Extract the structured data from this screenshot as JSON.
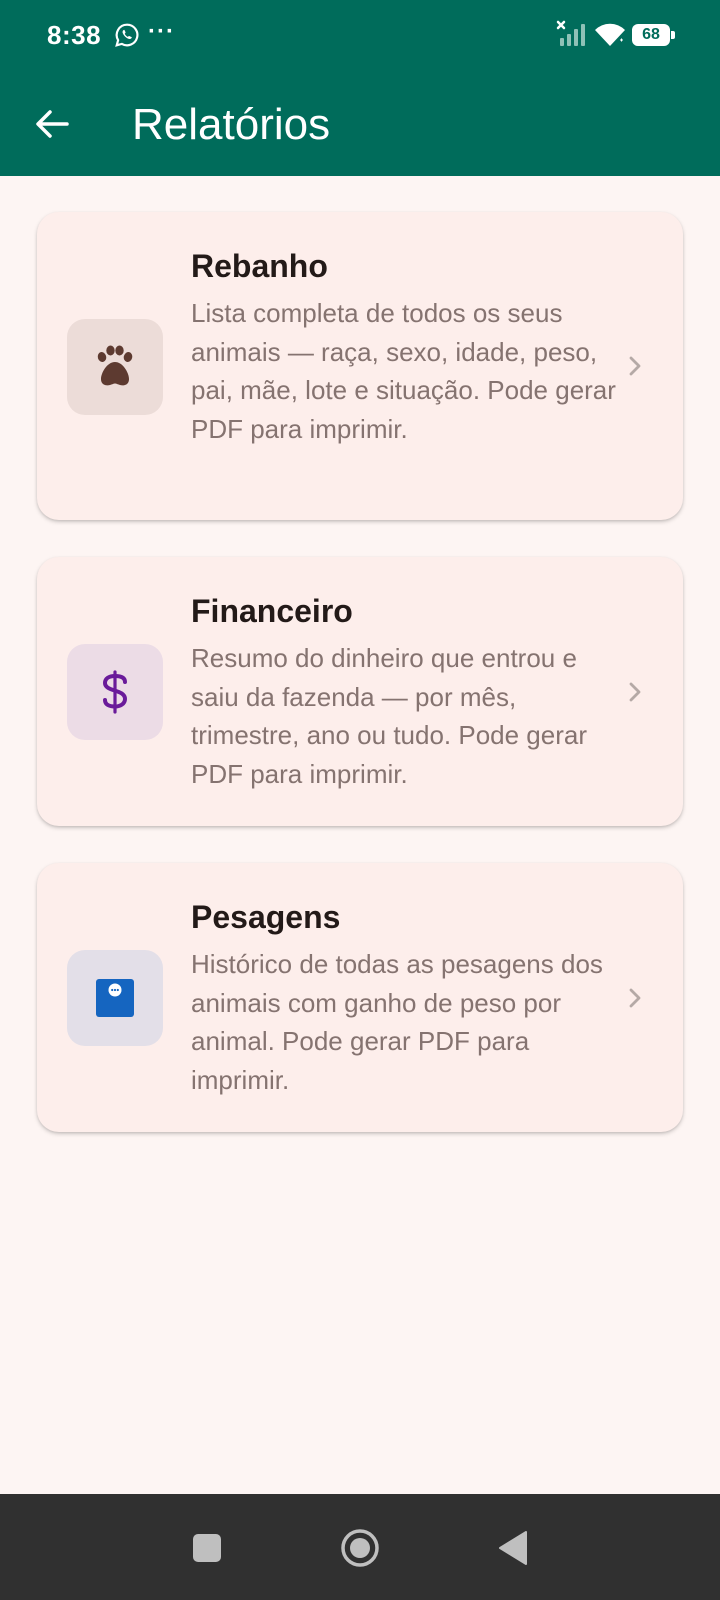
{
  "status_bar": {
    "time": "8:38",
    "more": "···",
    "battery": "68"
  },
  "app_bar": {
    "title": "Relatórios",
    "back_icon": "arrow-left-icon"
  },
  "reports": [
    {
      "title": "Rebanho",
      "description": "Lista completa de todos os seus animais — raça, sexo, idade, peso, pai, mãe, lote e situação. Pode gerar PDF para imprimir.",
      "icon": "paw-icon",
      "icon_bg": "#ecdcd8",
      "icon_color": "#5d3a30"
    },
    {
      "title": "Financeiro",
      "description": "Resumo do dinheiro que entrou e saiu da fazenda — por mês, trimestre, ano ou tudo. Pode gerar PDF para imprimir.",
      "icon": "dollar-icon",
      "icon_bg": "#ecdce6",
      "icon_color": "#6a1b9a"
    },
    {
      "title": "Pesagens",
      "description": "Histórico de todas as pesagens dos animais com ganho de peso por animal. Pode gerar PDF para imprimir.",
      "icon": "scale-icon",
      "icon_bg": "#e3dfe8",
      "icon_color": "#1565c0"
    }
  ],
  "colors": {
    "primary": "#006c5b",
    "background": "#fdf5f3",
    "card": "#fdeeeb"
  }
}
